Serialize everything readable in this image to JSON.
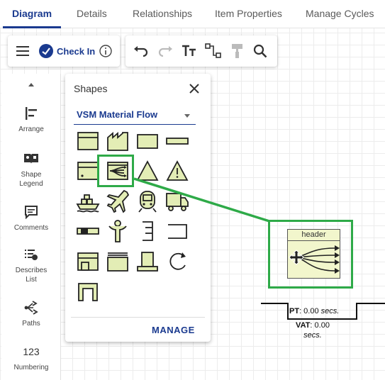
{
  "tabs": [
    {
      "label": "Diagram",
      "active": true
    },
    {
      "label": "Details",
      "active": false
    },
    {
      "label": "Relationships",
      "active": false
    },
    {
      "label": "Item Properties",
      "active": false
    },
    {
      "label": "Manage Cycles",
      "active": false
    }
  ],
  "toolbar": {
    "menu_icon": "hamburger-icon",
    "checkin_label": "Check In",
    "checkin_icon": "check-circle-icon",
    "info_icon": "info-icon",
    "undo_icon": "undo-icon",
    "redo_icon": "redo-icon",
    "text_icon": "text-format-icon",
    "connector_icon": "connector-icon",
    "format_painter_icon": "format-painter-icon",
    "search_icon": "search-icon"
  },
  "rail": {
    "items": [
      {
        "label": "Arrange",
        "icon": "arrange-icon"
      },
      {
        "label": "Shape Legend",
        "icon": "book-icon"
      },
      {
        "label": "Comments",
        "icon": "comment-icon"
      },
      {
        "label": "Describes List",
        "icon": "list-icon"
      },
      {
        "label": "Paths",
        "icon": "paths-icon"
      },
      {
        "label": "Numbering",
        "icon": "numbering-icon",
        "glyph": "123"
      }
    ]
  },
  "shapes_panel": {
    "title": "Shapes",
    "library": "VSM Material Flow",
    "manage_label": "MANAGE",
    "shapes": [
      "process-box",
      "factory",
      "rectangle",
      "bar",
      "data-box",
      "material-flow-selected",
      "inventory-triangle",
      "inventory-warning",
      "ship",
      "airplane",
      "train",
      "truck",
      "kanban-post",
      "operator",
      "supermarket",
      "buffer",
      "workstation",
      "stack",
      "podium",
      "pull-cycle",
      "gate"
    ],
    "fill_color": "#e3edb5",
    "stroke_color": "#222222"
  },
  "canvas": {
    "node_header": "header",
    "pt_label": "PT",
    "pt_value": ": 0.00",
    "pt_unit": "secs.",
    "vat_label": "VAT",
    "vat_value": ": 0.00",
    "vat_unit": "secs."
  },
  "colors": {
    "accent": "#1a3a8f",
    "highlight": "#2eaa48",
    "shape_fill": "#e3edb5",
    "node_fill": "#f2f6cc"
  }
}
